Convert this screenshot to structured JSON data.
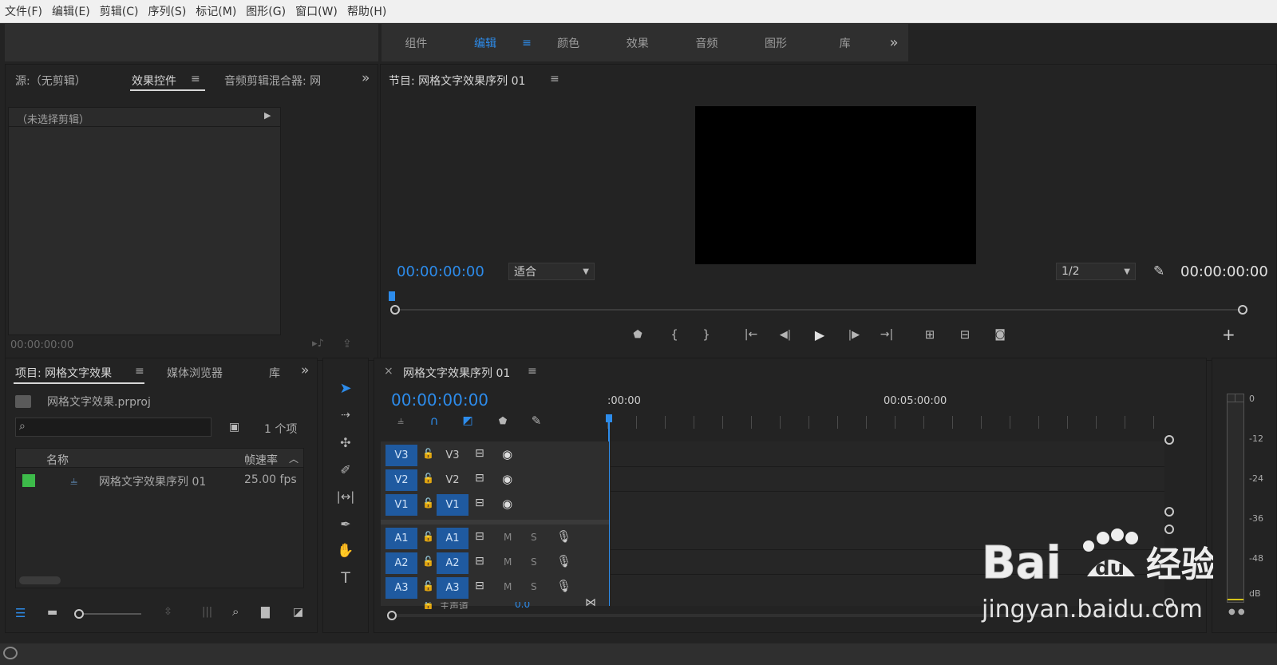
{
  "menu": [
    "文件(F)",
    "编辑(E)",
    "剪辑(C)",
    "序列(S)",
    "标记(M)",
    "图形(G)",
    "窗口(W)",
    "帮助(H)"
  ],
  "workspaces": {
    "items": [
      "组件",
      "编辑",
      "颜色",
      "效果",
      "音频",
      "图形",
      "库"
    ],
    "active": "编辑",
    "more": "»"
  },
  "source_panel": {
    "tabs": [
      "源:（无剪辑）",
      "效果控件",
      "音频剪辑混合器: 网"
    ],
    "active_tab": "效果控件",
    "no_clip": "（未选择剪辑）",
    "timecode": "00:00:00:00",
    "more": "»"
  },
  "program_monitor": {
    "title": "节目: 网格文字效果序列 01",
    "timecode_left": "00:00:00:00",
    "fit": "适合",
    "resolution": "1/2",
    "timecode_right": "00:00:00:00",
    "add": "+"
  },
  "project_panel": {
    "tabs": [
      "项目: 网格文字效果",
      "媒体浏览器",
      "库"
    ],
    "active_tab": "项目: 网格文字效果",
    "file": "网格文字效果.prproj",
    "count": "1 个项",
    "columns": {
      "name": "名称",
      "rate": "帧速率"
    },
    "rows": [
      {
        "name": "网格文字效果序列 01",
        "rate": "25.00 fps",
        "color": "#3dbb4a"
      }
    ],
    "more": "»"
  },
  "timeline": {
    "close": "×",
    "title": "网格文字效果序列 01",
    "timecode": "00:00:00:00",
    "ruler": [
      ":00:00",
      "00:05:00:00"
    ],
    "video_tracks": [
      "V3",
      "V2",
      "V1"
    ],
    "audio_tracks": [
      "A1",
      "A2",
      "A3"
    ],
    "m": "M",
    "s": "S",
    "master": "主声道",
    "master_val": "0.0"
  },
  "meter": {
    "labels": [
      "0",
      "-12",
      "-24",
      "-36",
      "-48",
      "dB"
    ]
  },
  "watermark": {
    "line2": "jingyan.baidu.com"
  },
  "colors": {
    "accent": "#2d8ceb",
    "bg": "#232323",
    "panel_header": "#2f2f2f"
  }
}
